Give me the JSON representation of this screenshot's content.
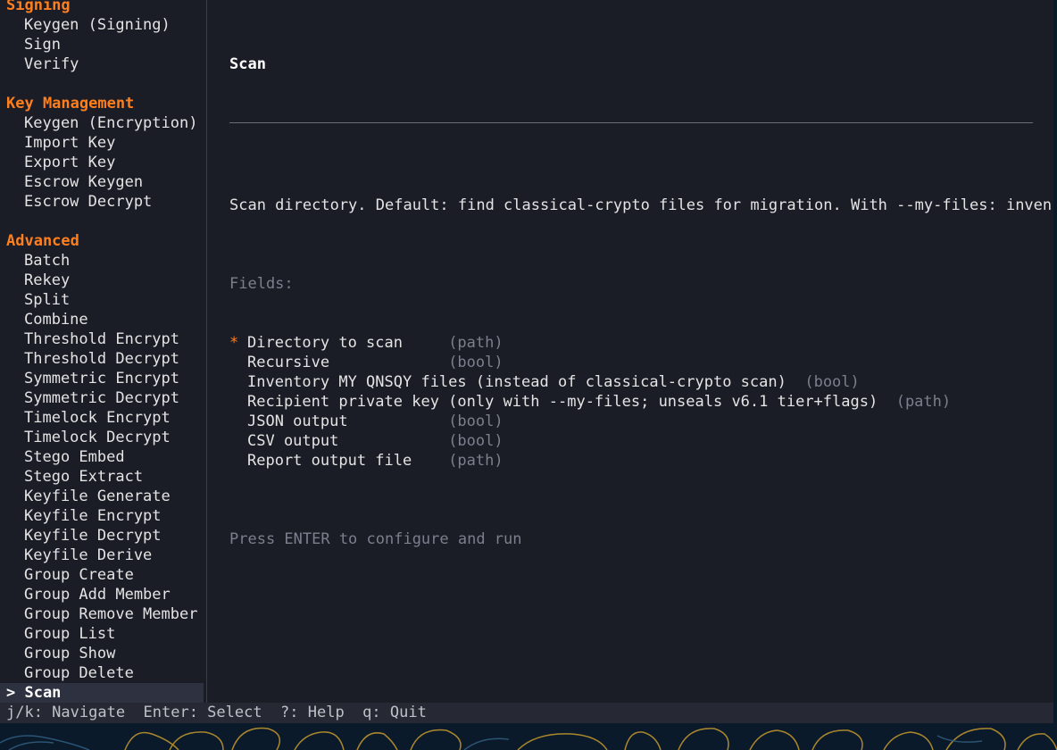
{
  "sidebar": {
    "sections": [
      {
        "title": "Signing",
        "items": [
          "Keygen (Signing)",
          "Sign",
          "Verify"
        ]
      },
      {
        "title": "Key Management",
        "items": [
          "Keygen (Encryption)",
          "Import Key",
          "Export Key",
          "Escrow Keygen",
          "Escrow Decrypt"
        ]
      },
      {
        "title": "Advanced",
        "items": [
          "Batch",
          "Rekey",
          "Split",
          "Combine",
          "Threshold Encrypt",
          "Threshold Decrypt",
          "Symmetric Encrypt",
          "Symmetric Decrypt",
          "Timelock Encrypt",
          "Timelock Decrypt",
          "Stego Embed",
          "Stego Extract",
          "Keyfile Generate",
          "Keyfile Encrypt",
          "Keyfile Decrypt",
          "Keyfile Derive",
          "Group Create",
          "Group Add Member",
          "Group Remove Member",
          "Group List",
          "Group Show",
          "Group Delete"
        ]
      }
    ],
    "selected_label": "> Scan"
  },
  "main": {
    "title": "Scan",
    "description": "Scan directory. Default: find classical-crypto files for migration. With --my-files: inventory",
    "fields_label": "Fields:",
    "required_marker": "*",
    "fields": [
      {
        "name": "Directory to scan",
        "type": "(path)",
        "required": true,
        "pad": "     "
      },
      {
        "name": "Recursive",
        "type": "(bool)",
        "required": false,
        "pad": "             "
      },
      {
        "name": "Inventory MY QNSQY files (instead of classical-crypto scan)",
        "type": "(bool)",
        "required": false,
        "pad": "  "
      },
      {
        "name": "Recipient private key (only with --my-files; unseals v6.1 tier+flags)",
        "type": "(path)",
        "required": false,
        "pad": "  "
      },
      {
        "name": "JSON output",
        "type": "(bool)",
        "required": false,
        "pad": "           "
      },
      {
        "name": "CSV output",
        "type": "(bool)",
        "required": false,
        "pad": "            "
      },
      {
        "name": "Report output file",
        "type": "(path)",
        "required": false,
        "pad": "    "
      }
    ],
    "hint": "Press ENTER to configure and run"
  },
  "statusbar": {
    "text": "j/k: Navigate  Enter: Select  ?: Help  q: Quit"
  },
  "colors": {
    "accent": "#ff7f1e",
    "background": "#1a1c26",
    "muted": "#7c7f8c",
    "selected_bg": "#2e3140"
  }
}
